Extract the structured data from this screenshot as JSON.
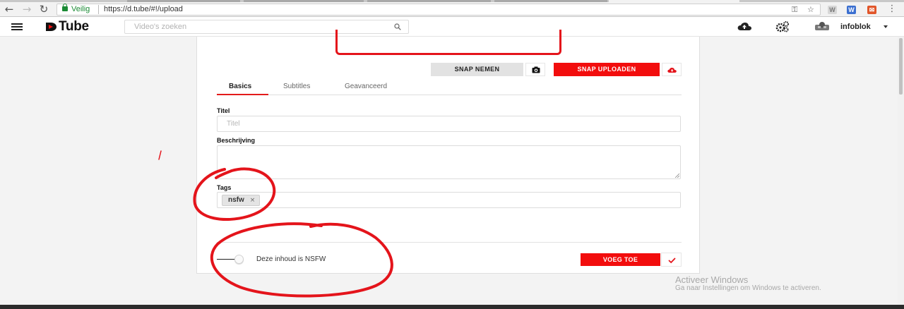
{
  "browser": {
    "secure_label": "Veilig",
    "url": "https://d.tube/#!/upload",
    "back_icon": "back-arrow-icon",
    "forward_icon": "forward-arrow-icon",
    "reload_icon": "reload-icon"
  },
  "app": {
    "logo_text": "Tube",
    "search_placeholder": "Video's zoeken",
    "username": "infoblok",
    "brand_color": "#f20d0d"
  },
  "upload": {
    "snap_take_label": "SNAP NEMEN",
    "snap_upload_label": "SNAP UPLOADEN",
    "tabs": [
      {
        "label": "Basics"
      },
      {
        "label": "Subtitles"
      },
      {
        "label": "Geavanceerd"
      }
    ],
    "title_label": "Titel",
    "title_placeholder": "Titel",
    "description_label": "Beschrijving",
    "tags_label": "Tags",
    "tags": [
      {
        "label": "nsfw"
      }
    ],
    "tag_remove_glyph": "×",
    "nsfw_toggle_label": "Deze inhoud is NSFW",
    "nsfw_enabled": false,
    "add_button_label": "VOEG TOE"
  },
  "os_watermark": {
    "title": "Activeer Windows",
    "subtitle": "Ga naar Instellingen om Windows te activeren."
  },
  "annotation_color": "#e4141b"
}
